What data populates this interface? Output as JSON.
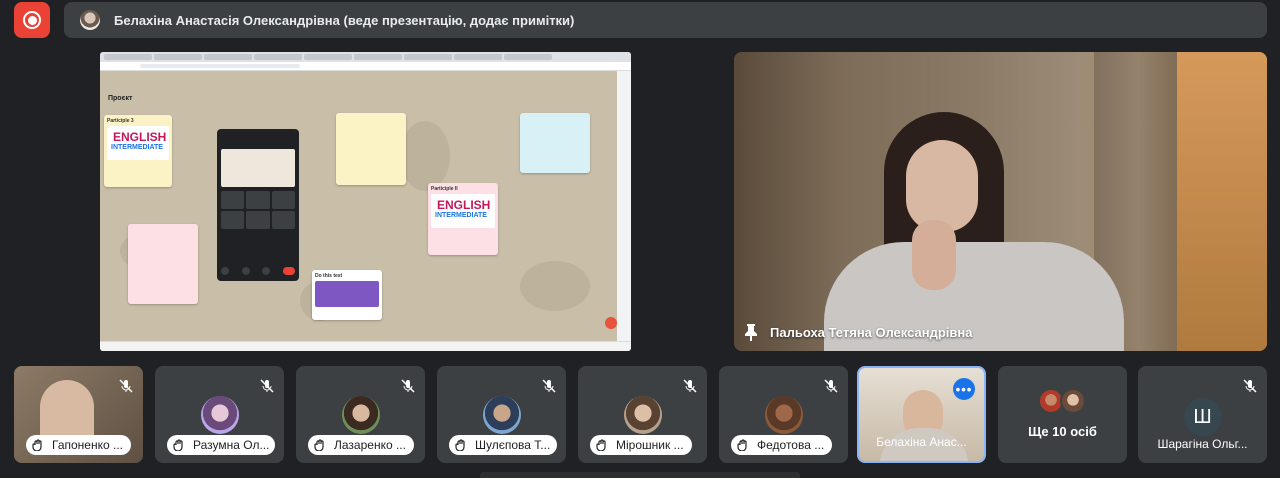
{
  "header": {
    "presenter_text": "Белахіна Анастасія Олександрівна (веде презентацію, додає примітки)"
  },
  "screen_share": {
    "board_title": "Проєкт",
    "notes": [
      {
        "title": "Participle 3",
        "card_big": "ENGLISH",
        "card_mid": "INTERMEDIATE"
      },
      {
        "title": "Participle II",
        "card_big": "ENGLISH",
        "card_mid": "INTERMEDIATE"
      },
      {
        "title": "Do this test"
      }
    ]
  },
  "pinned": {
    "name": "Пальоха Тетяна Олександрівна",
    "icon": "pin-icon"
  },
  "filmstrip": [
    {
      "name": "Гапоненко ...",
      "muted": true,
      "type": "video"
    },
    {
      "name": "Разумна Ол...",
      "muted": true,
      "type": "avatar"
    },
    {
      "name": "Лазаренко ...",
      "muted": true,
      "type": "avatar"
    },
    {
      "name": "Шулєпова Т...",
      "muted": true,
      "type": "avatar"
    },
    {
      "name": "Мірошник ...",
      "muted": true,
      "type": "avatar"
    },
    {
      "name": "Федотова ...",
      "muted": true,
      "type": "avatar"
    },
    {
      "name": "Белахіна Анас...",
      "muted": false,
      "type": "video",
      "active": true
    },
    {
      "name": "Ще 10 осіб",
      "type": "more"
    },
    {
      "name": "Шарагіна Ольг...",
      "muted": true,
      "type": "letter",
      "letter": "Ш"
    }
  ],
  "colors": {
    "background": "#202124",
    "tile": "#3c4043",
    "record": "#ea4335",
    "accent": "#1a73e8",
    "active_border": "#8ab4f8"
  }
}
